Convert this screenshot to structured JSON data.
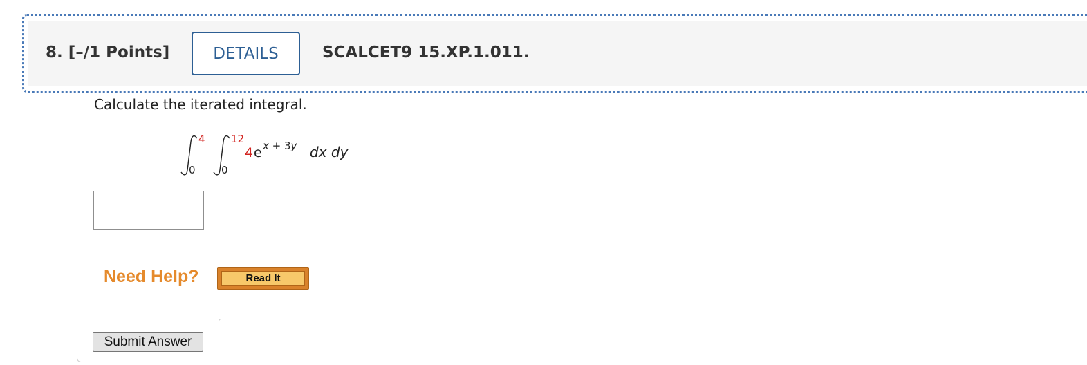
{
  "question": {
    "number_points": "8. [–/1 Points]",
    "details_label": "DETAILS",
    "code": "SCALCET9 15.XP.1.011."
  },
  "prompt": "Calculate the iterated integral.",
  "integral": {
    "outer_upper": "4",
    "outer_lower": "0",
    "inner_upper": "12",
    "inner_lower": "0",
    "coefficient": "4",
    "base": "e",
    "exponent_x": "x",
    "exponent_op": " + 3",
    "exponent_y": "y",
    "differentials": "dx dy"
  },
  "answer": {
    "value": ""
  },
  "help": {
    "label": "Need Help?",
    "read_it_label": "Read It"
  },
  "submit_label": "Submit Answer",
  "colors": {
    "accent_blue": "#2d5f94",
    "help_orange": "#e58a2c",
    "red_value": "#d2231f"
  }
}
